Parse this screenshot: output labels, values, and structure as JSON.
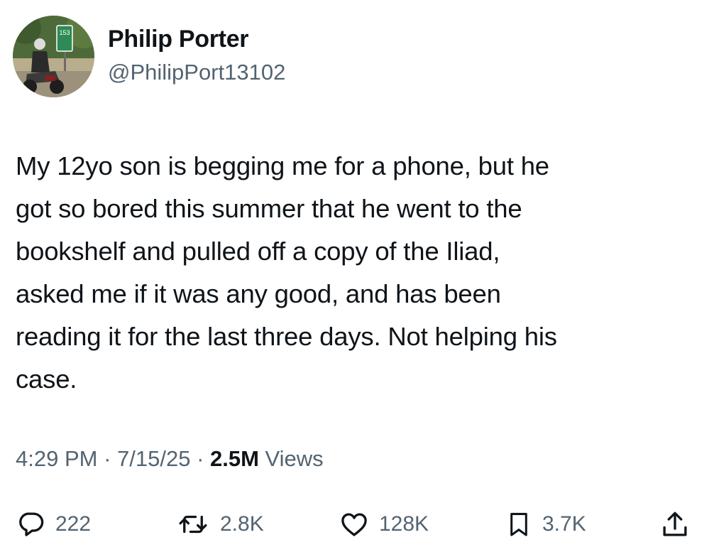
{
  "author": {
    "name": "Philip Porter",
    "handle": "@PhilipPort13102",
    "avatar": {
      "icon": "avatar-motorcyclist-photo",
      "sign_text": "153"
    }
  },
  "tweet": {
    "text": "My 12yo son is begging me for a phone, but he\ngot so bored this summer that he went to the\nbookshelf and pulled off a copy of the Iliad,\nasked me if it was any good, and has been\nreading it for the last three days. Not helping his\ncase."
  },
  "meta": {
    "time": "4:29 PM",
    "separator": " · ",
    "date": "7/15/25",
    "views_count": "2.5M",
    "views_label": " Views"
  },
  "actions": {
    "replies": {
      "icon": "reply-icon",
      "count": "222"
    },
    "reposts": {
      "icon": "repost-icon",
      "count": "2.8K"
    },
    "likes": {
      "icon": "heart-icon",
      "count": "128K"
    },
    "bookmarks": {
      "icon": "bookmark-icon",
      "count": "3.7K"
    },
    "share": {
      "icon": "share-icon"
    }
  },
  "colors": {
    "text_primary": "#0f1419",
    "text_secondary": "#536471",
    "background": "#ffffff"
  }
}
